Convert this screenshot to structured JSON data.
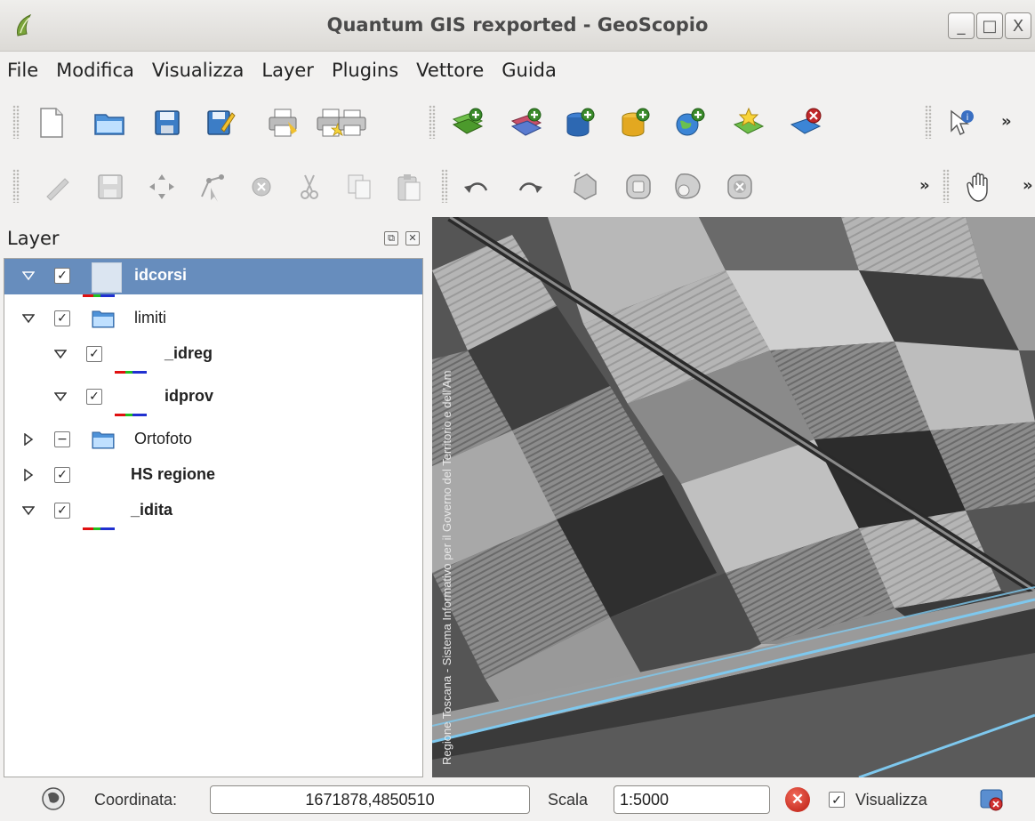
{
  "window": {
    "title": "Quantum GIS rexported - GeoScopio",
    "buttons": [
      "_",
      "□",
      "X"
    ]
  },
  "menu": [
    "File",
    "Modifica",
    "Visualizza",
    "Layer",
    "Plugins",
    "Vettore",
    "Guida"
  ],
  "toolbar1": {
    "icons": [
      "new-project-icon",
      "open-project-icon",
      "save-project-icon",
      "save-as-icon",
      "print-composer-icon",
      "new-composer-icon",
      "print-icon",
      "add-vector-layer-icon",
      "add-raster-layer-icon",
      "add-postgis-layer-icon",
      "add-spatialite-layer-icon",
      "add-wms-layer-icon",
      "new-vector-layer-icon",
      "remove-layer-icon",
      "whats-this-icon"
    ],
    "overflow": "»"
  },
  "toolbar2": {
    "icons": [
      "toggle-editing-icon",
      "save-edits-icon",
      "move-feature-icon",
      "node-tool-icon",
      "delete-selected-icon",
      "cut-features-icon",
      "copy-features-icon",
      "paste-features-icon",
      "undo-icon",
      "redo-icon",
      "simplify-feature-icon",
      "add-ring-icon",
      "add-part-icon",
      "delete-ring-icon",
      "pan-icon"
    ],
    "overflow": "»"
  },
  "layers_panel": {
    "title": "Layer",
    "layers": [
      {
        "name": "idcorsi",
        "expanded": true,
        "checked": true,
        "bold": true,
        "selected": true,
        "indent": 0,
        "kind": "vector"
      },
      {
        "name": "limiti",
        "expanded": true,
        "checked": true,
        "bold": false,
        "selected": false,
        "indent": 0,
        "kind": "group"
      },
      {
        "name": "_idreg",
        "expanded": true,
        "checked": true,
        "bold": true,
        "selected": false,
        "indent": 1,
        "kind": "vector"
      },
      {
        "name": "idprov",
        "expanded": true,
        "checked": true,
        "bold": true,
        "selected": false,
        "indent": 1,
        "kind": "vector"
      },
      {
        "name": "Ortofoto",
        "expanded": false,
        "checked": "partial",
        "bold": false,
        "selected": false,
        "indent": 0,
        "kind": "group"
      },
      {
        "name": "HS regione",
        "expanded": false,
        "checked": true,
        "bold": true,
        "selected": false,
        "indent": 0,
        "kind": "raster"
      },
      {
        "name": "_idita",
        "expanded": true,
        "checked": true,
        "bold": true,
        "selected": false,
        "indent": 0,
        "kind": "vector"
      }
    ]
  },
  "map": {
    "credits": "Regione Toscana - Sistema Informativo per il Governo del Territorio e dell'Am"
  },
  "statusbar": {
    "coord_label": "Coordinata:",
    "coord_value": "1671878,4850510",
    "scale_label": "Scala",
    "scale_value": "1:5000",
    "render_label": "Visualizza",
    "render_checked": true
  },
  "colors": {
    "selection": "#678dbd",
    "river_lines": "#7ec8ee"
  }
}
